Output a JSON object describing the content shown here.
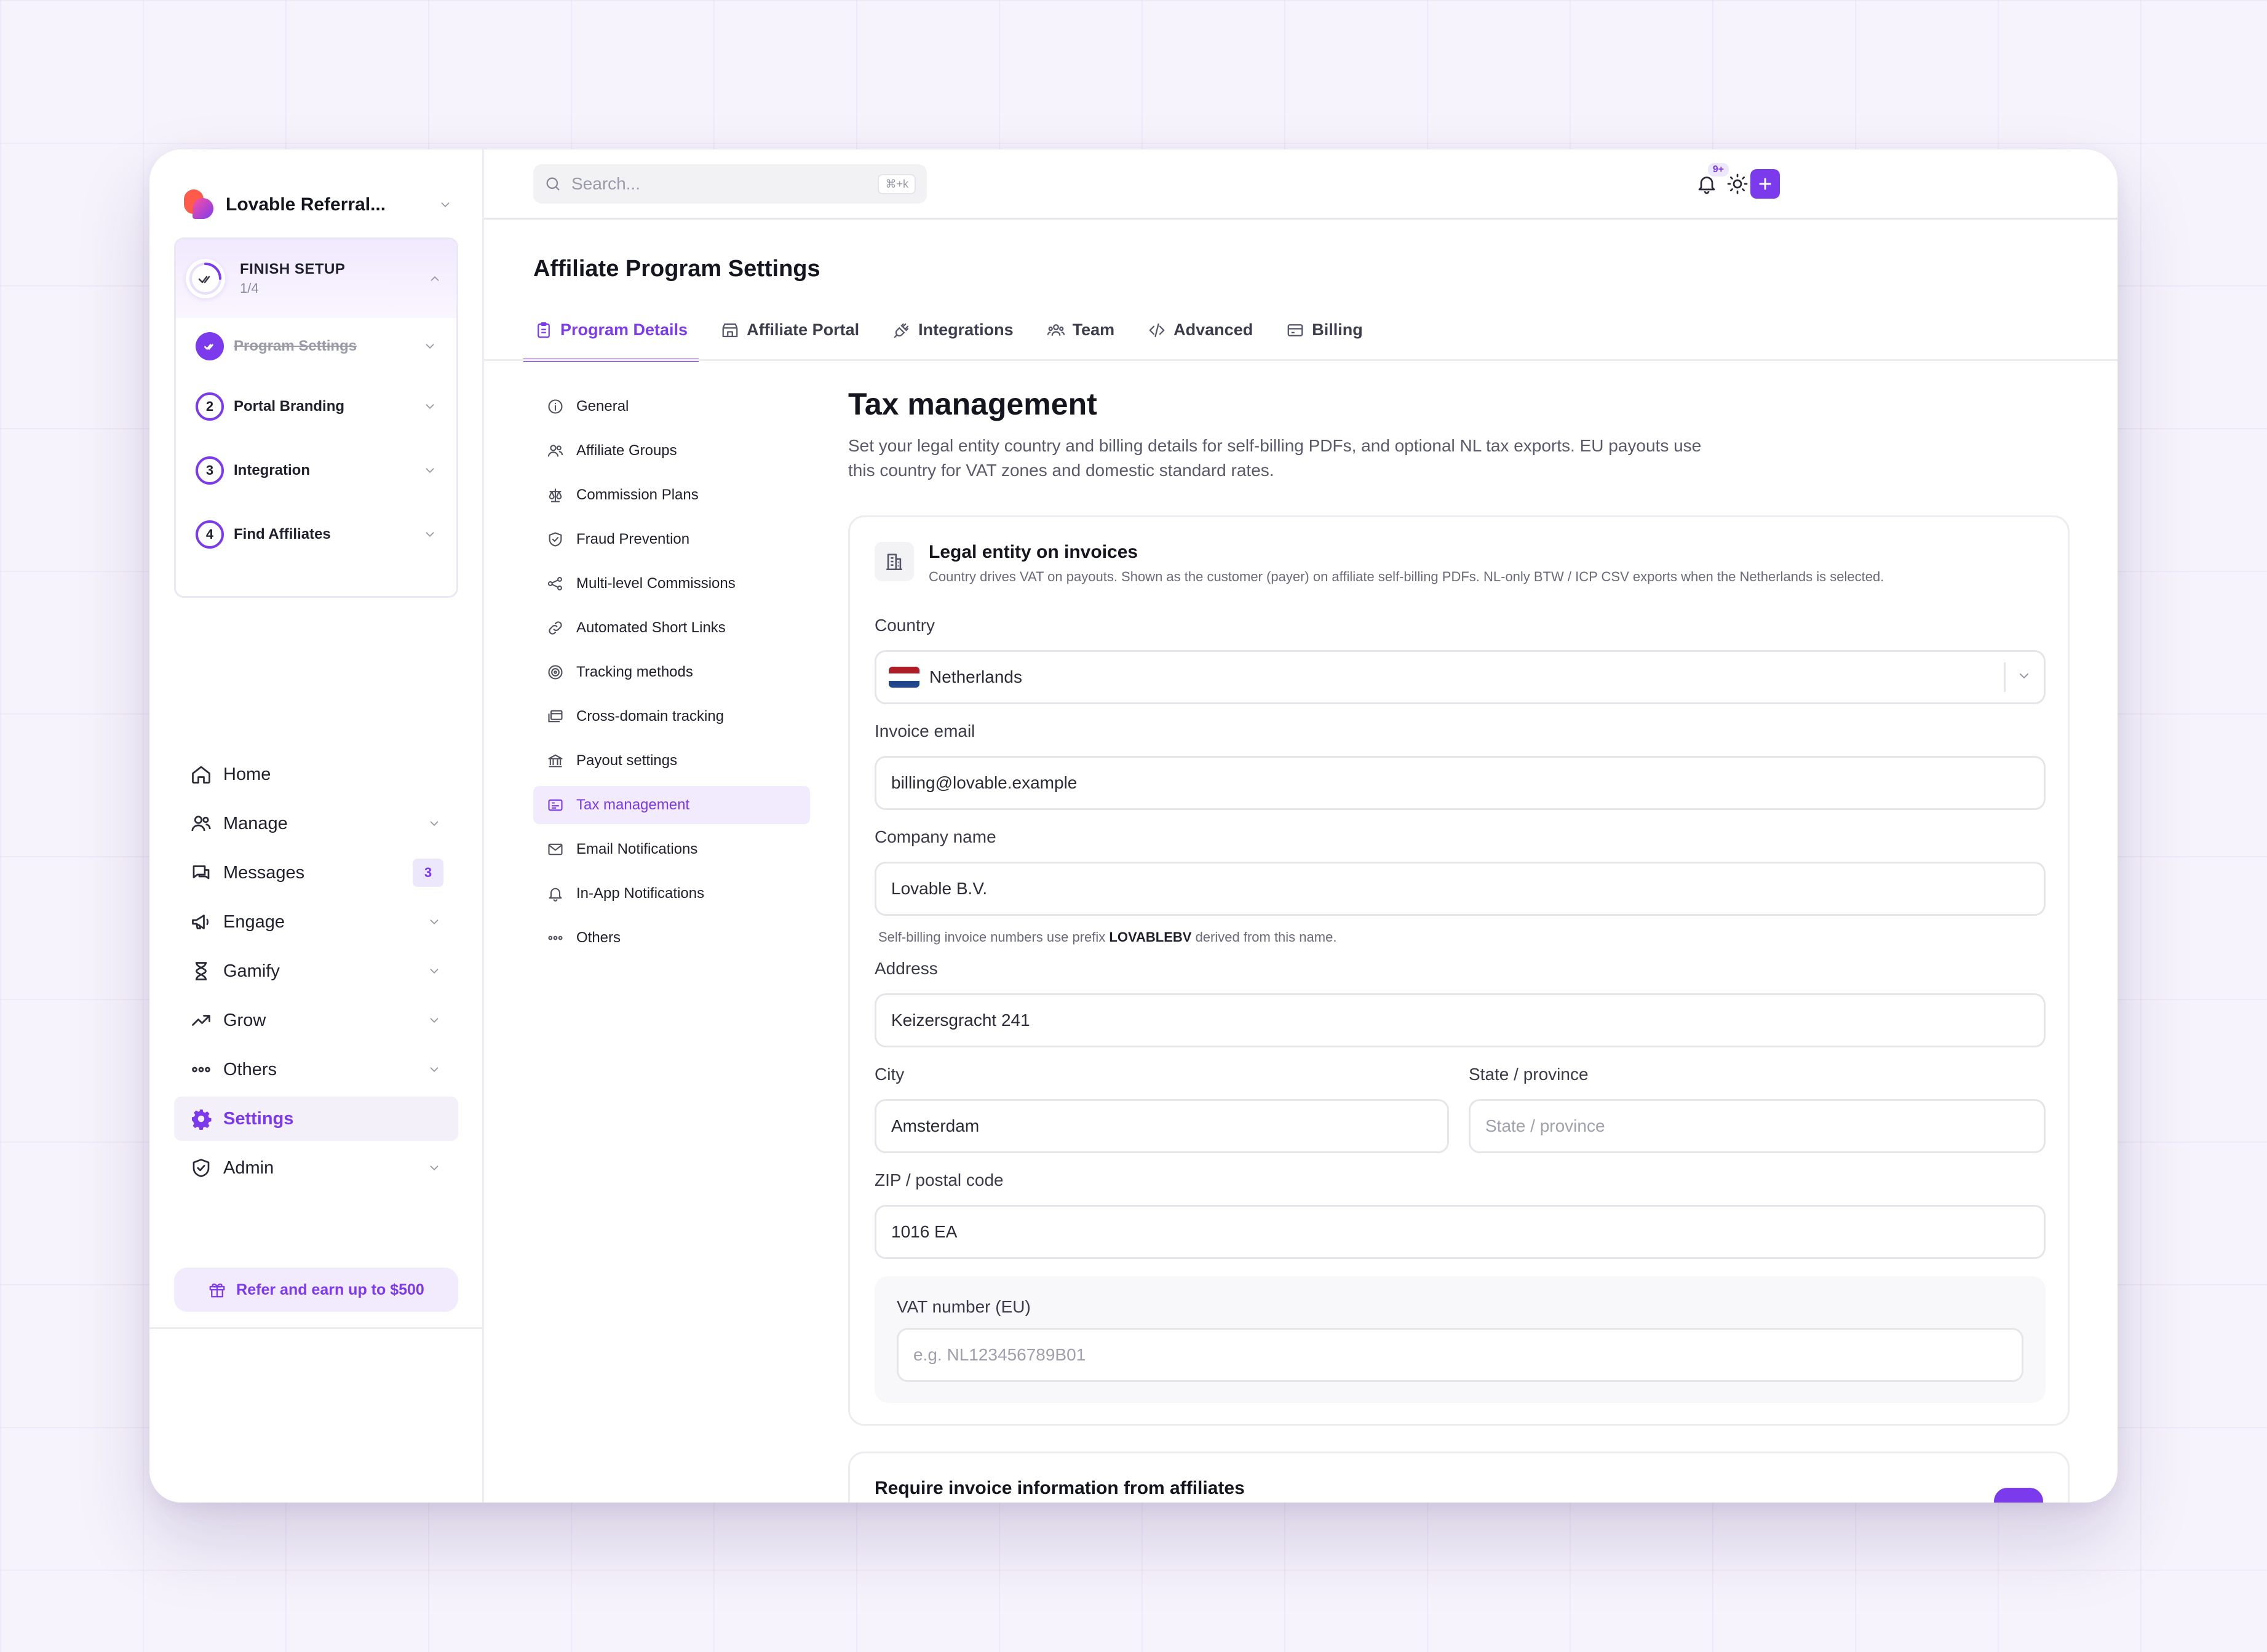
{
  "org": {
    "name": "Lovable Referral..."
  },
  "setup": {
    "title": "FINISH SETUP",
    "progress": "1/4",
    "progress_fraction": 0.25,
    "steps": [
      {
        "number": "",
        "label": "Program Settings",
        "done": true
      },
      {
        "number": "2",
        "label": "Portal Branding",
        "done": false
      },
      {
        "number": "3",
        "label": "Integration",
        "done": false
      },
      {
        "number": "4",
        "label": "Find Affiliates",
        "done": false
      }
    ]
  },
  "nav": {
    "items": [
      {
        "label": "Home",
        "icon": "home-icon"
      },
      {
        "label": "Manage",
        "icon": "users-icon"
      },
      {
        "label": "Messages",
        "icon": "chat-icon",
        "badge": "3"
      },
      {
        "label": "Engage",
        "icon": "megaphone-icon"
      },
      {
        "label": "Gamify",
        "icon": "hourglass-icon"
      },
      {
        "label": "Grow",
        "icon": "trending-up-icon"
      },
      {
        "label": "Others",
        "icon": "dots-icon"
      },
      {
        "label": "Settings",
        "icon": "gear-icon",
        "active": true
      },
      {
        "label": "Admin",
        "icon": "shield-icon"
      }
    ]
  },
  "refer": {
    "label": "Refer and earn up to $500"
  },
  "topbar": {
    "search_placeholder": "Search...",
    "search_shortcut": "⌘+k",
    "notification_count": "9+"
  },
  "page": {
    "title": "Affiliate Program Settings"
  },
  "tabs": [
    {
      "label": "Program Details",
      "icon": "clipboard-icon",
      "active": true
    },
    {
      "label": "Affiliate Portal",
      "icon": "store-icon"
    },
    {
      "label": "Integrations",
      "icon": "plug-icon"
    },
    {
      "label": "Team",
      "icon": "team-icon"
    },
    {
      "label": "Advanced",
      "icon": "code-icon"
    },
    {
      "label": "Billing",
      "icon": "card-icon"
    }
  ],
  "subnav": [
    {
      "label": "General",
      "icon": "info-icon"
    },
    {
      "label": "Affiliate Groups",
      "icon": "users-icon"
    },
    {
      "label": "Commission Plans",
      "icon": "scale-icon"
    },
    {
      "label": "Fraud Prevention",
      "icon": "shield-check-icon"
    },
    {
      "label": "Multi-level Commissions",
      "icon": "network-icon"
    },
    {
      "label": "Automated Short Links",
      "icon": "link-icon"
    },
    {
      "label": "Tracking methods",
      "icon": "target-icon"
    },
    {
      "label": "Cross-domain tracking",
      "icon": "windows-icon"
    },
    {
      "label": "Payout settings",
      "icon": "bank-icon"
    },
    {
      "label": "Tax management",
      "icon": "receipt-icon",
      "active": true
    },
    {
      "label": "Email Notifications",
      "icon": "mail-icon"
    },
    {
      "label": "In-App Notifications",
      "icon": "bell-icon"
    },
    {
      "label": "Others",
      "icon": "dots-icon"
    }
  ],
  "content": {
    "title": "Tax management",
    "description": "Set your legal entity country and billing details for self-billing PDFs, and optional NL tax exports. EU payouts use this country for VAT zones and domestic standard rates.",
    "card": {
      "title": "Legal entity on invoices",
      "subtitle": "Country drives VAT on payouts. Shown as the customer (payer) on affiliate self-billing PDFs. NL-only BTW / ICP CSV exports when the Netherlands is selected."
    },
    "fields": {
      "country_label": "Country",
      "country_value": "Netherlands",
      "email_label": "Invoice email",
      "email_value": "billing@lovable.example",
      "company_label": "Company name",
      "company_value": "Lovable B.V.",
      "company_hint_pre": "Self-billing invoice numbers use prefix ",
      "company_hint_prefix": "LOVABLEBV",
      "company_hint_post": " derived from this name.",
      "address_label": "Address",
      "address_value": "Keizersgracht 241",
      "city_label": "City",
      "city_value": "Amsterdam",
      "state_label": "State / province",
      "state_placeholder": "State / province",
      "zip_label": "ZIP / postal code",
      "zip_value": "1016 EA",
      "vat_label": "VAT number (EU)",
      "vat_placeholder": "e.g. NL123456789B01"
    },
    "card2": {
      "title": "Require invoice information from affiliates"
    }
  },
  "colors": {
    "accent": "#7c3aed",
    "flag_red": "#ae1c28",
    "flag_white": "#ffffff",
    "flag_blue": "#21468b"
  }
}
